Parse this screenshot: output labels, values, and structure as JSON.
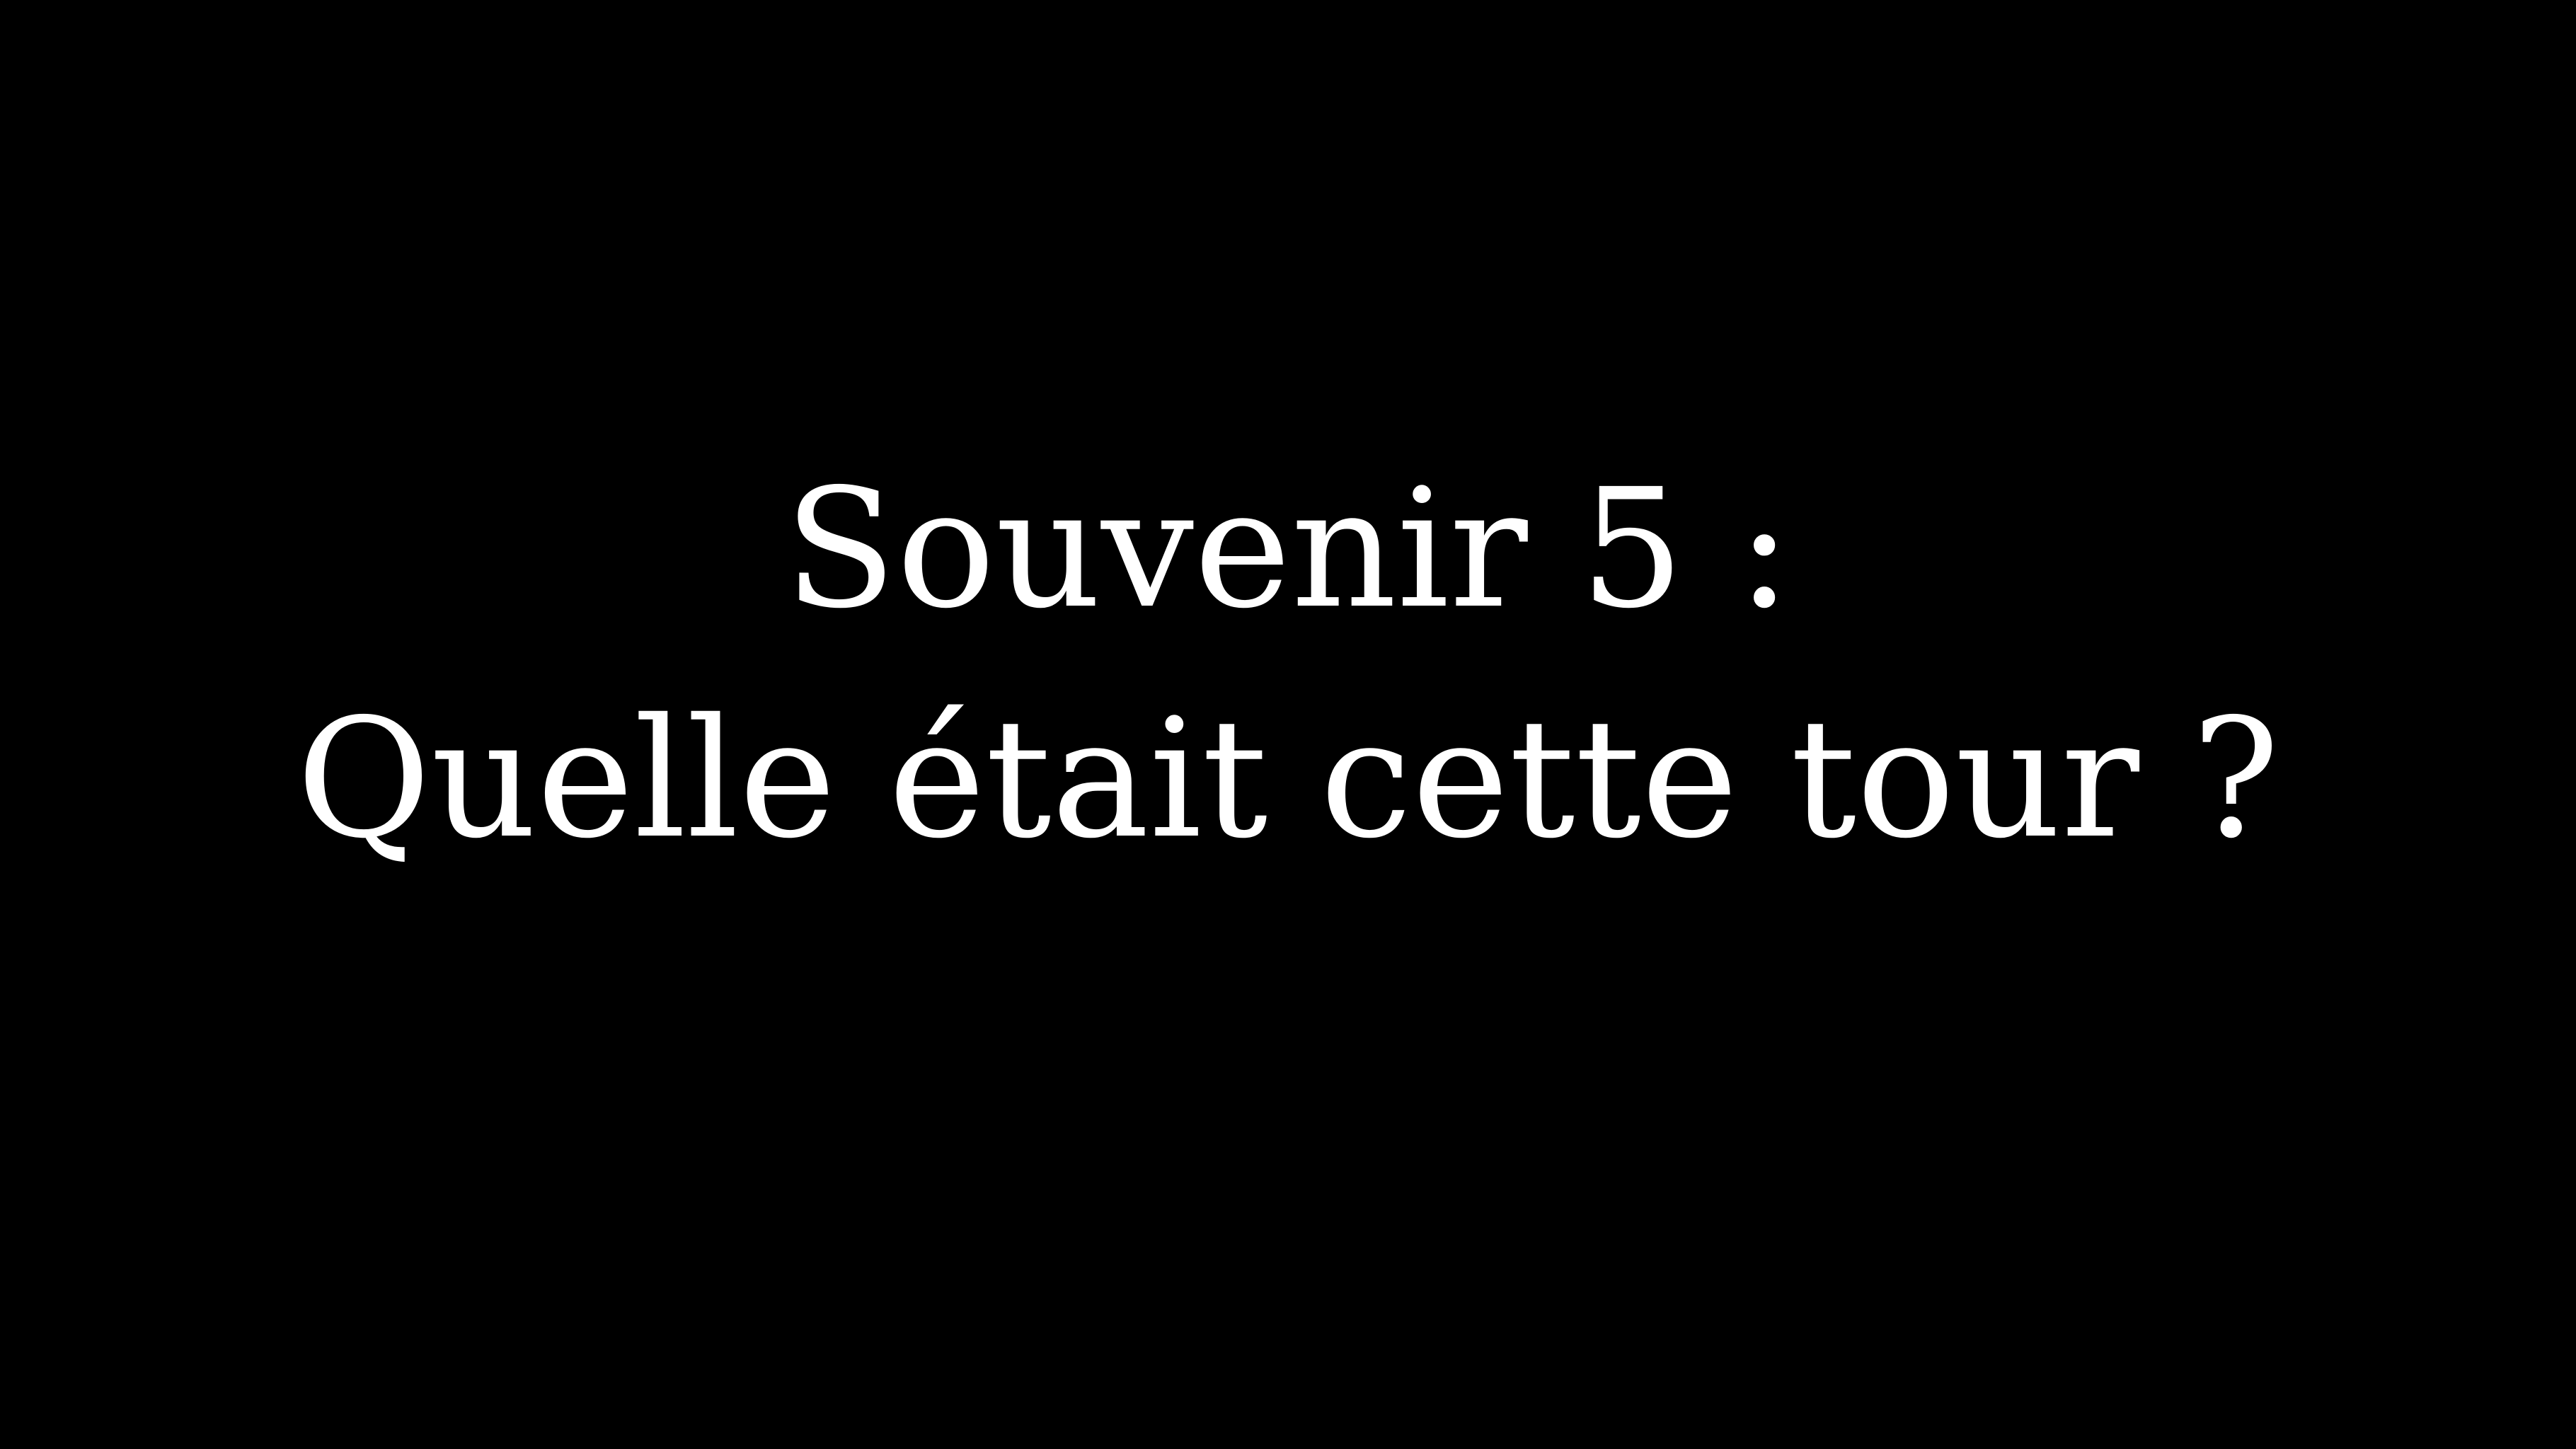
{
  "slide": {
    "background_color": "#000000",
    "text_color": "#ffffff",
    "line_1": "Souvenir 5 :",
    "line_2": "Quelle était cette tour ?"
  }
}
